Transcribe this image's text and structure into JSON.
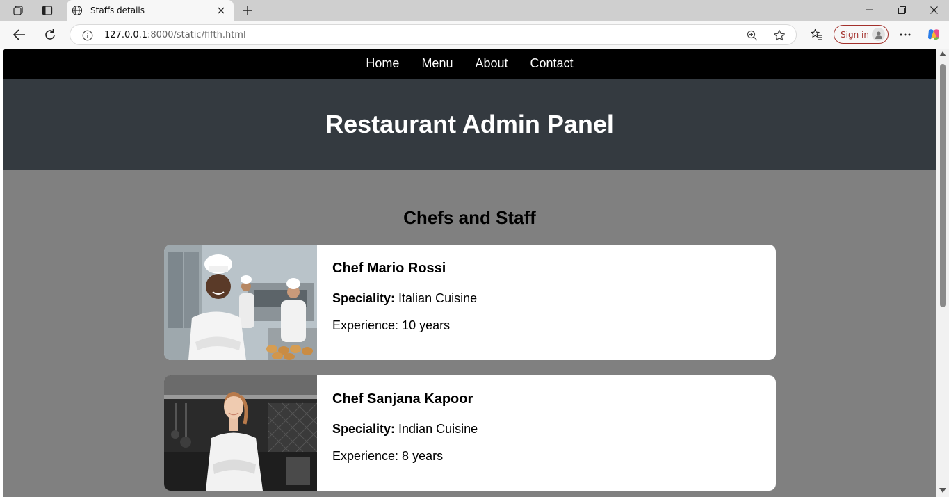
{
  "browser": {
    "tab_title": "Staffs details",
    "url_host": "127.0.0.1",
    "url_path": ":8000/static/fifth.html",
    "signin_label": "Sign in"
  },
  "nav": {
    "items": [
      "Home",
      "Menu",
      "About",
      "Contact"
    ]
  },
  "header": {
    "title": "Restaurant Admin Panel"
  },
  "staff_section": {
    "title": "Chefs and Staff",
    "speciality_label": "Speciality:",
    "chefs": [
      {
        "name": "Chef Mario Rossi",
        "speciality": " Italian Cuisine",
        "experience": "Experience: 10 years"
      },
      {
        "name": "Chef Sanjana Kapoor",
        "speciality": " Indian Cuisine",
        "experience": "Experience: 8 years"
      }
    ]
  },
  "colors": {
    "nav_bg": "#000000",
    "header_bg": "#343a40",
    "page_bg": "#808080",
    "card_bg": "#ffffff",
    "signin_accent": "#a3302b"
  }
}
